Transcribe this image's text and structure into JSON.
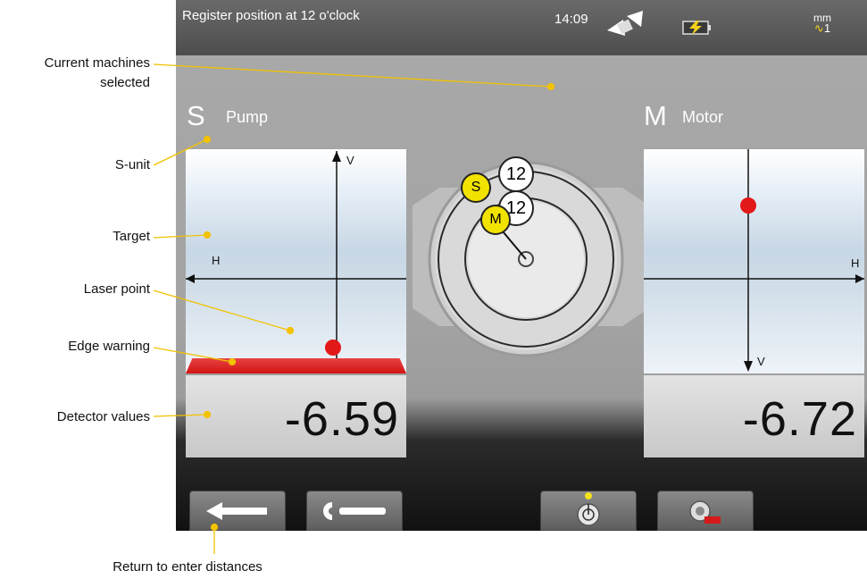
{
  "status_bar": {
    "title": "Register position at 12 o'clock",
    "time": "14:09",
    "unit": "mm",
    "unit_sub": "1"
  },
  "s_machine": {
    "letter": "S",
    "name": "Pump",
    "value": "-6.59"
  },
  "m_machine": {
    "letter": "M",
    "name": "Motor",
    "value": "-6.72"
  },
  "target": {
    "h_label": "H",
    "v_label": "V"
  },
  "dial": {
    "s_badge": "S",
    "m_badge": "M",
    "s_position": "12",
    "m_position": "12"
  },
  "annotations": {
    "current_machines": "Current machines selected",
    "s_unit": "S-unit",
    "target": "Target",
    "laser_point": "Laser point",
    "edge_warning": "Edge warning",
    "detector_values": "Detector values",
    "return": "Return to enter distances"
  },
  "colors": {
    "accent": "#f2c200",
    "warning": "#dd1a1a",
    "status_bg": "#555555"
  },
  "icons": [
    "sensor-icon",
    "battery-icon",
    "back-arrow-icon",
    "wrench-icon",
    "measure-icon",
    "camera-icon"
  ]
}
